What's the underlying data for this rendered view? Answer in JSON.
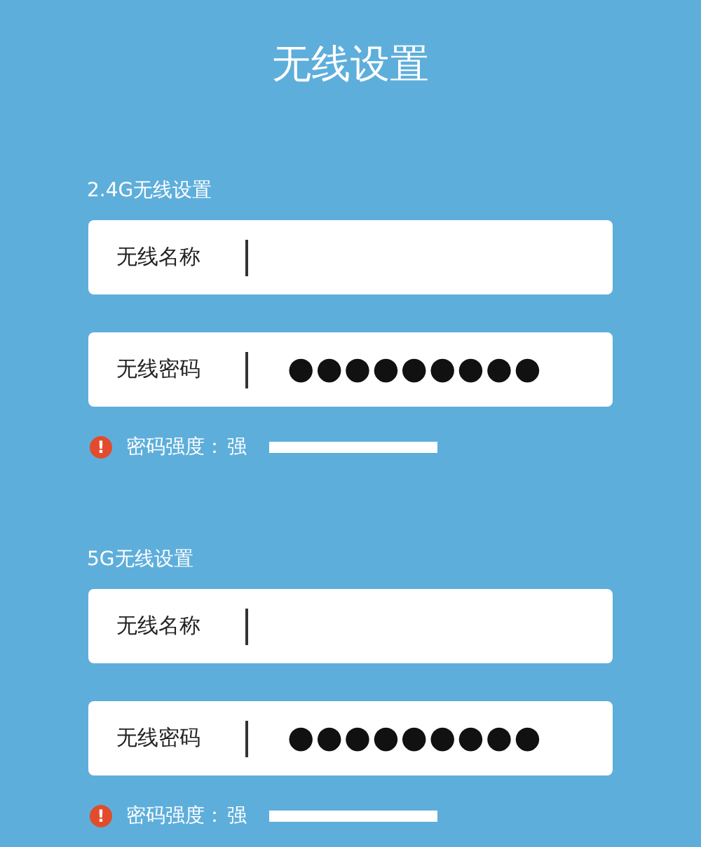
{
  "title": "无线设置",
  "sections": [
    {
      "heading": "2.4G无线设置",
      "fields": [
        {
          "label": "无线名称",
          "kind": "text"
        },
        {
          "label": "无线密码",
          "kind": "password",
          "value": "●●●●●●●●●"
        }
      ],
      "strength": {
        "icon": "!",
        "label": "密码强度：",
        "value": "强"
      }
    },
    {
      "heading": "5G无线设置",
      "fields": [
        {
          "label": "无线名称",
          "kind": "text"
        },
        {
          "label": "无线密码",
          "kind": "password",
          "value": "●●●●●●●●●"
        }
      ],
      "strength": {
        "icon": "!",
        "label": "密码强度：",
        "value": "强"
      }
    }
  ]
}
